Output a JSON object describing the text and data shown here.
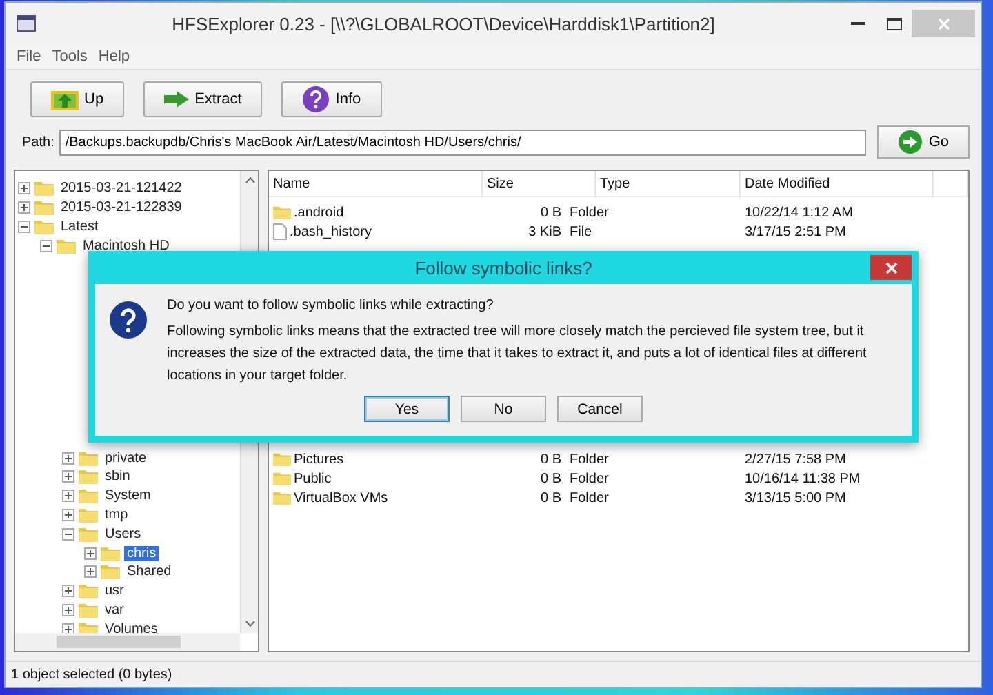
{
  "window": {
    "title": "HFSExplorer 0.23 - [\\\\?\\GLOBALROOT\\Device\\Harddisk1\\Partition2]"
  },
  "menu": [
    "File",
    "Tools",
    "Help"
  ],
  "toolbar": [
    {
      "kind": "up",
      "label": "Up"
    },
    {
      "kind": "extract",
      "label": "Extract"
    },
    {
      "kind": "info",
      "label": "Info"
    }
  ],
  "path": {
    "label": "Path:",
    "value": "/Backups.backupdb/Chris's MacBook Air/Latest/Macintosh HD/Users/chris/",
    "button": "Go"
  },
  "tree": [
    {
      "label": "2015-03-21-121422",
      "expanded": false,
      "selected": false
    },
    {
      "label": "2015-03-21-122839",
      "expanded": false,
      "selected": false
    },
    {
      "label": "Latest",
      "expanded": true,
      "selected": false,
      "children": [
        {
          "label": "Macintosh HD",
          "expanded": true,
          "selected": false,
          "children": [
            {
              "label": "private",
              "expanded": false,
              "selected": false
            },
            {
              "label": "sbin",
              "expanded": false,
              "selected": false
            },
            {
              "label": "System",
              "expanded": false,
              "selected": false
            },
            {
              "label": "tmp",
              "expanded": false,
              "selected": false
            },
            {
              "label": "Users",
              "expanded": true,
              "selected": false,
              "children": [
                {
                  "label": "chris",
                  "expanded": false,
                  "selected": true
                },
                {
                  "label": "Shared",
                  "expanded": false,
                  "selected": false
                }
              ]
            },
            {
              "label": "usr",
              "expanded": false,
              "selected": false
            },
            {
              "label": "var",
              "expanded": false,
              "selected": false
            },
            {
              "label": "Volumes",
              "expanded": false,
              "selected": false
            }
          ]
        }
      ]
    }
  ],
  "table": {
    "columns": [
      "Name",
      "Size",
      "Type",
      "Date Modified"
    ],
    "rows_top": [
      {
        "kind": "folder",
        "name": ".android",
        "size": "0 B",
        "type": "Folder",
        "date": "10/22/14 1:12 AM"
      },
      {
        "kind": "file",
        "name": ".bash_history",
        "size": "3 KiB",
        "type": "File",
        "date": "3/17/15 2:51 PM"
      }
    ],
    "rows_bottom": [
      {
        "kind": "folder",
        "name": "Pictures",
        "size": "0 B",
        "type": "Folder",
        "date": "2/27/15 7:58 PM"
      },
      {
        "kind": "folder",
        "name": "Public",
        "size": "0 B",
        "type": "Folder",
        "date": "10/16/14 11:38 PM"
      },
      {
        "kind": "folder",
        "name": "VirtualBox VMs",
        "size": "0 B",
        "type": "Folder",
        "date": "3/13/15 5:00 PM"
      }
    ]
  },
  "status_bar": "1 object selected (0 bytes)",
  "dialog": {
    "title": "Follow symbolic links?",
    "question": "Do you want to follow symbolic links while extracting?",
    "message": "Following symbolic links means that the extracted tree will more closely match the percieved file system tree, but it increases the size of the extracted data, the time that it takes to extract it, and puts a lot of identical files at different locations in your target folder.",
    "buttons": [
      {
        "label": "Yes",
        "selected": true
      },
      {
        "label": "No",
        "selected": false
      },
      {
        "label": "Cancel",
        "selected": false
      }
    ]
  }
}
